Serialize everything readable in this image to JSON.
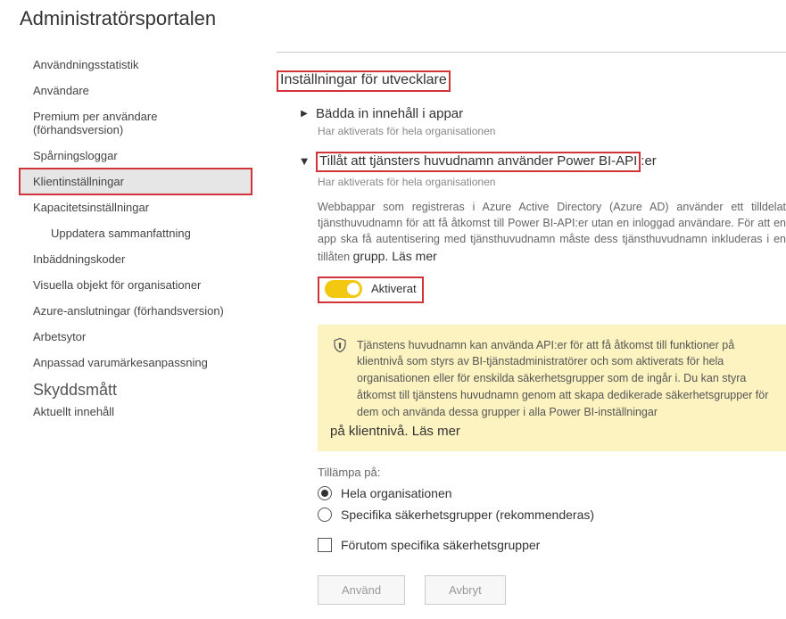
{
  "page_title": "Administratörsportalen",
  "sidebar": {
    "items": [
      "Användningsstatistik",
      "Användare",
      "Premium per användare (förhandsversion)",
      "Spårningsloggar",
      "Klientinställningar",
      "Kapacitetsinställningar",
      "Uppdatera sammanfattning",
      "Inbäddningskoder",
      "Visuella objekt för organisationer",
      "Azure-anslutningar (förhandsversion)",
      "Arbetsytor",
      "Anpassad varumärkesanpassning"
    ],
    "section_head": "Skyddsmått",
    "section_item": "Aktuellt innehåll"
  },
  "dev": {
    "section_title": "Inställningar för utvecklare",
    "embed": {
      "title": "Bädda in innehåll i appar",
      "sub": "Har aktiverats för hela organisationen"
    },
    "spn": {
      "title_pre": "Tillåt att tjänsters huvudnamn använder Power BI-API",
      "title_suffix": ":er",
      "sub": "Har aktiverats för hela organisationen",
      "desc": "Webbappar som registreras i Azure Active Directory (Azure AD) använder ett tilldelat tjänsthuvudnamn för att få åtkomst till Power BI-API:er utan en inloggad användare. För att en app ska få autentisering med tjänsthuvudnamn måste dess tjänsthuvudnamn inkluderas i en tillåten",
      "more_prefix": "grupp.",
      "more_link": "Läs mer",
      "toggle_label": "Aktiverat",
      "info": "Tjänstens huvudnamn kan använda API:er för att få åtkomst till funktioner på klientnivå som styrs av BI-tjänstadministratörer och som aktiverats för hela organisationen eller för enskilda säkerhetsgrupper som de ingår i. Du kan styra åtkomst till tjänstens huvudnamn genom att skapa dedikerade säkerhetsgrupper för dem och använda dessa grupper i alla Power BI-inställningar",
      "info_more_prefix": "på klientnivå.",
      "info_more_link": "Läs mer",
      "apply_label": "Tillämpa på:",
      "radio1": "Hela organisationen",
      "radio2": "Specifika säkerhetsgrupper (rekommenderas)",
      "checkbox": "Förutom specifika säkerhetsgrupper",
      "btn_apply": "Använd",
      "btn_cancel": "Avbryt"
    }
  }
}
